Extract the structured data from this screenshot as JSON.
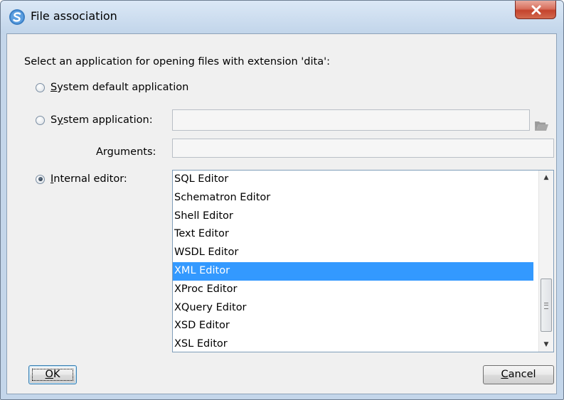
{
  "window": {
    "title": "File association",
    "close_label": "close"
  },
  "dialog": {
    "prompt": "Select an application for opening files with extension 'dita':",
    "options": {
      "system_default": {
        "mnemonic": "S",
        "rest": "ystem default application",
        "checked": false
      },
      "system_app": {
        "pre": "S",
        "mnemonic": "y",
        "rest": "stem application:",
        "checked": false
      },
      "internal_editor": {
        "mnemonic": "I",
        "rest": "nternal editor:",
        "checked": true
      }
    },
    "system_app_value": "",
    "arguments_label": "Arguments:",
    "arguments_value": "",
    "editors": [
      "SQL Editor",
      "Schematron Editor",
      "Shell Editor",
      "Text Editor",
      "WSDL Editor",
      "XML Editor",
      "XProc Editor",
      "XQuery Editor",
      "XSD Editor",
      "XSL Editor"
    ],
    "selected_editor": "XML Editor",
    "buttons": {
      "ok": {
        "mnemonic": "O",
        "rest": "K"
      },
      "cancel": {
        "mnemonic": "C",
        "rest": "ancel"
      }
    }
  },
  "icons": {
    "app": "oxygen-app-icon",
    "close": "close-icon",
    "browse": "folder-icon",
    "scroll_up": "scroll-up-arrow-icon",
    "scroll_down": "scroll-down-arrow-icon"
  },
  "colors": {
    "selection": "#3399ff",
    "close_button": "#c4432d",
    "titlebar": "#c2d5ea"
  }
}
